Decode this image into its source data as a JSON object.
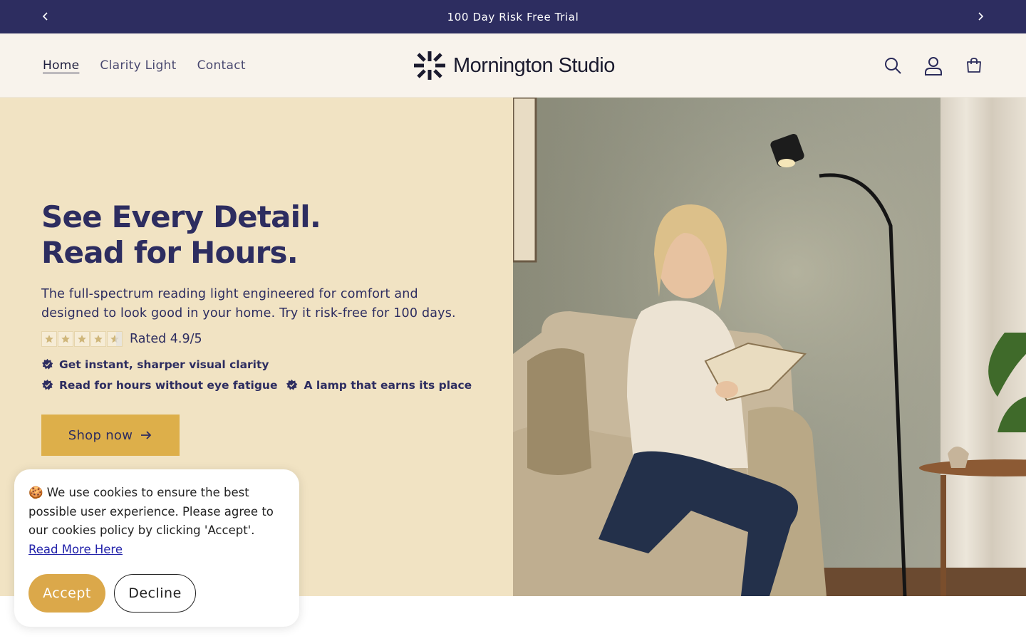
{
  "announcement": {
    "text": "100 Day Risk Free Trial",
    "prev_icon": "chevron-left-icon",
    "next_icon": "chevron-right-icon"
  },
  "header": {
    "nav": [
      {
        "label": "Home",
        "active": true
      },
      {
        "label": "Clarity Light",
        "active": false
      },
      {
        "label": "Contact",
        "active": false
      }
    ],
    "logo_text": "Mornington Studio",
    "icons": [
      "search-icon",
      "account-icon",
      "cart-icon"
    ]
  },
  "hero": {
    "headline_line1": "See Every Detail.",
    "headline_line2": "Read for Hours.",
    "subtext": "The full-spectrum reading light engineered for comfort and designed to look good in your home. Try it risk-free for 100 days.",
    "rating": {
      "value": 4.9,
      "max": 5,
      "text": "Rated 4.9/5"
    },
    "bullets": [
      "Get instant, sharper visual clarity",
      "Read for hours without eye fatigue",
      "A lamp that earns its place"
    ],
    "cta_label": "Shop now"
  },
  "cookie": {
    "emoji": "🍪",
    "text": "We use cookies to ensure the best possible user experience. Please agree to our cookies policy by clicking 'Accept'.",
    "link_text": "Read More Here",
    "accept_label": "Accept",
    "decline_label": "Decline"
  },
  "colors": {
    "navy": "#2d2d60",
    "cream": "#f8f3ec",
    "hero_bg": "#f1e3c3",
    "gold": "#ddaf4a",
    "accept": "#dba84a"
  }
}
